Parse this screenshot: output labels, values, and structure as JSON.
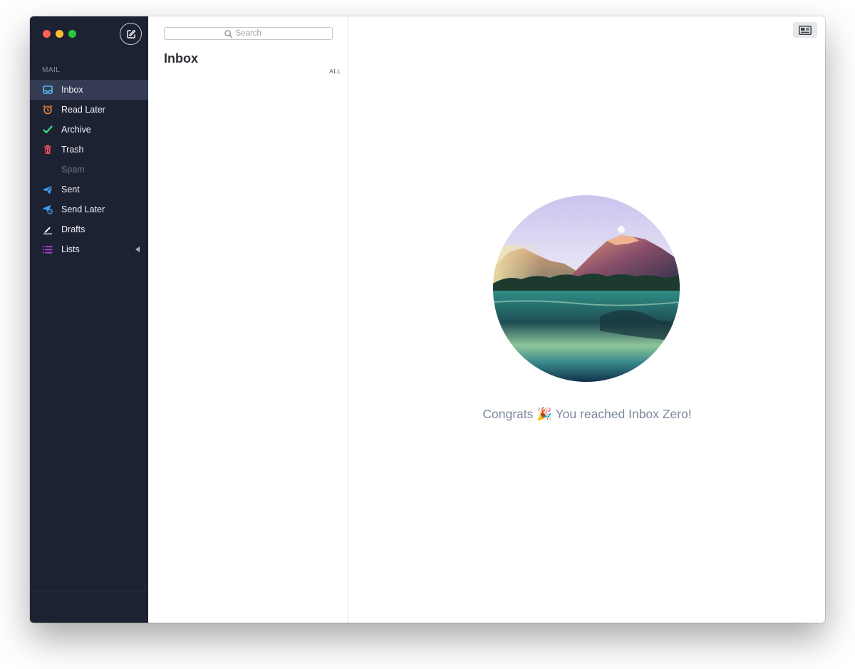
{
  "sidebar": {
    "section_label": "MAIL",
    "items": [
      {
        "label": "Inbox",
        "icon": "inbox-icon",
        "color": "#4fc3f7",
        "active": true
      },
      {
        "label": "Read Later",
        "icon": "alarm-clock-icon",
        "color": "#f0883e"
      },
      {
        "label": "Archive",
        "icon": "checkmark-icon",
        "color": "#3ddc84"
      },
      {
        "label": "Trash",
        "icon": "trash-icon",
        "color": "#f04e57"
      },
      {
        "label": "Spam",
        "icon": "",
        "muted": true
      },
      {
        "label": "Sent",
        "icon": "paper-plane-icon",
        "color": "#3e9cf5"
      },
      {
        "label": "Send Later",
        "icon": "paper-plane-clock-icon",
        "color": "#3e9cf5"
      },
      {
        "label": "Drafts",
        "icon": "pencil-icon",
        "color": "#ffffff"
      },
      {
        "label": "Lists",
        "icon": "list-icon",
        "color": "#c040e0",
        "has_submenu": true
      }
    ]
  },
  "list_pane": {
    "search_placeholder": "Search",
    "title": "Inbox",
    "filter": "ALL"
  },
  "reader": {
    "message_before": "Congrats",
    "emoji": "🎉",
    "message_after": "You reached Inbox Zero!"
  }
}
